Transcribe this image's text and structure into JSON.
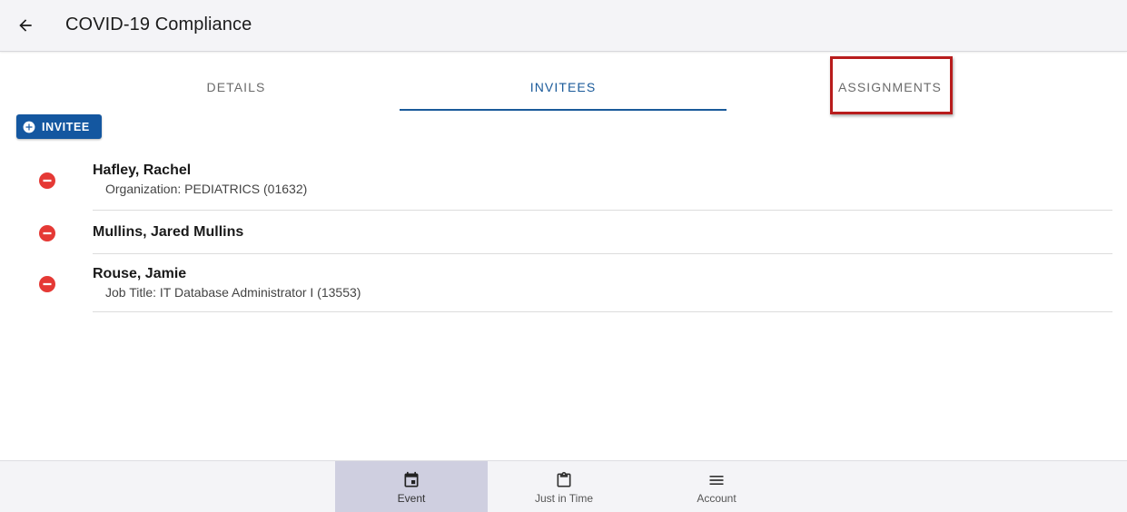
{
  "header": {
    "title": "COVID-19 Compliance",
    "back_icon": "arrow-left-icon"
  },
  "tabs": [
    {
      "label": "DETAILS",
      "active": false
    },
    {
      "label": "INVITEES",
      "active": true
    },
    {
      "label": "ASSIGNMENTS",
      "active": false
    }
  ],
  "toolbar": {
    "add_invitee_label": "INVITEE",
    "add_icon": "plus-circle-icon"
  },
  "invitees": [
    {
      "name": "Hafley, Rachel",
      "detail": "Organization: PEDIATRICS (01632)"
    },
    {
      "name": "Mullins, Jared Mullins",
      "detail": ""
    },
    {
      "name": "Rouse, Jamie",
      "detail": "Job Title: IT Database Administrator I (13553)"
    }
  ],
  "bottom_nav": [
    {
      "label": "Event",
      "icon": "calendar-icon",
      "active": true
    },
    {
      "label": "Just in Time",
      "icon": "clipboard-icon",
      "active": false
    },
    {
      "label": "Account",
      "icon": "menu-icon",
      "active": false
    }
  ],
  "colors": {
    "primary": "#1457a0",
    "active_tab": "#1a5a9a",
    "remove": "#e53935",
    "highlight": "#b81c1c",
    "nav_active_bg": "#cfcfe0"
  }
}
